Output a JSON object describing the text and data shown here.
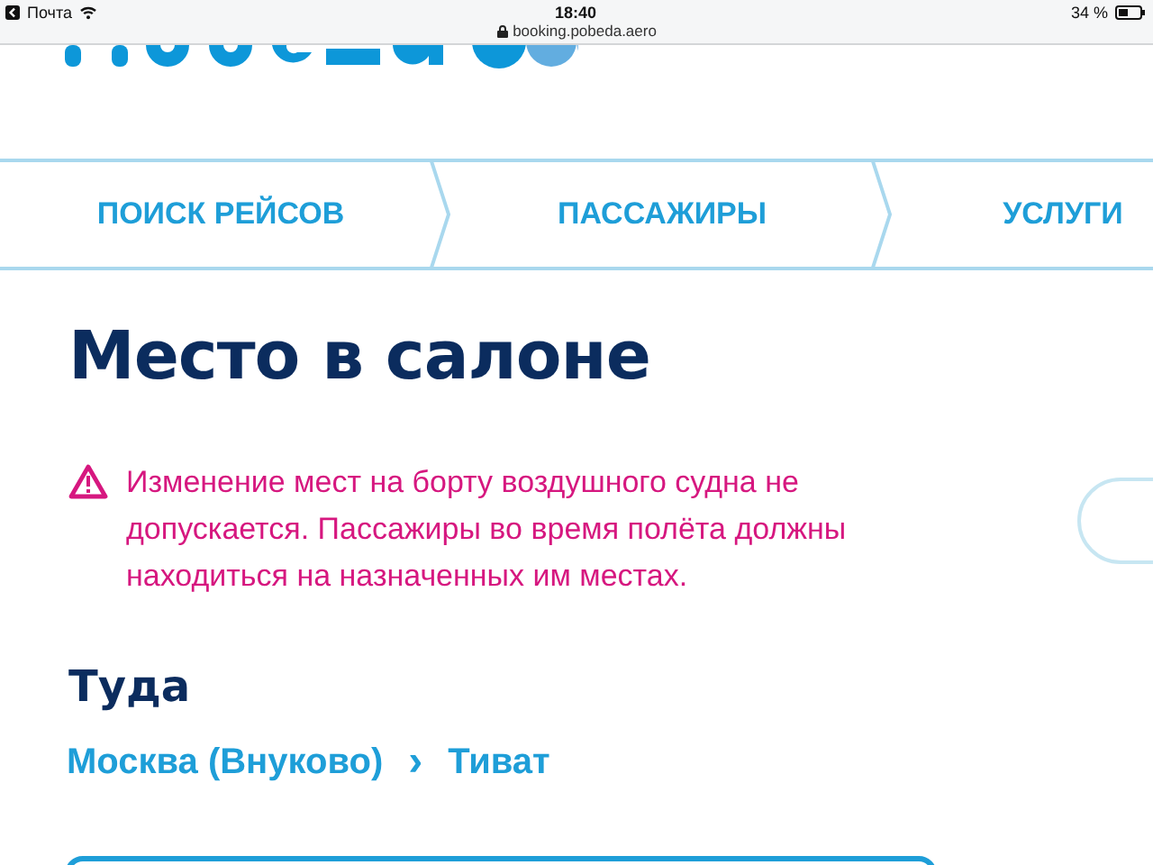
{
  "status_bar": {
    "back_app": "Почта",
    "time": "18:40",
    "url": "booking.pobeda.aero",
    "battery": "34 %"
  },
  "steps": [
    {
      "label": "ПОИСК РЕЙСОВ"
    },
    {
      "label": "ПАССАЖИРЫ"
    },
    {
      "label": "УСЛУГИ"
    }
  ],
  "title": "Место в салоне",
  "warning": "Изменение мест на борту воздушного судна не допускается. Пассажиры во время полёта должны находиться на назначенных им местах.",
  "direction": {
    "title": "Туда",
    "from": "Москва (Внуково)",
    "separator": "›",
    "to": "Тиват"
  }
}
